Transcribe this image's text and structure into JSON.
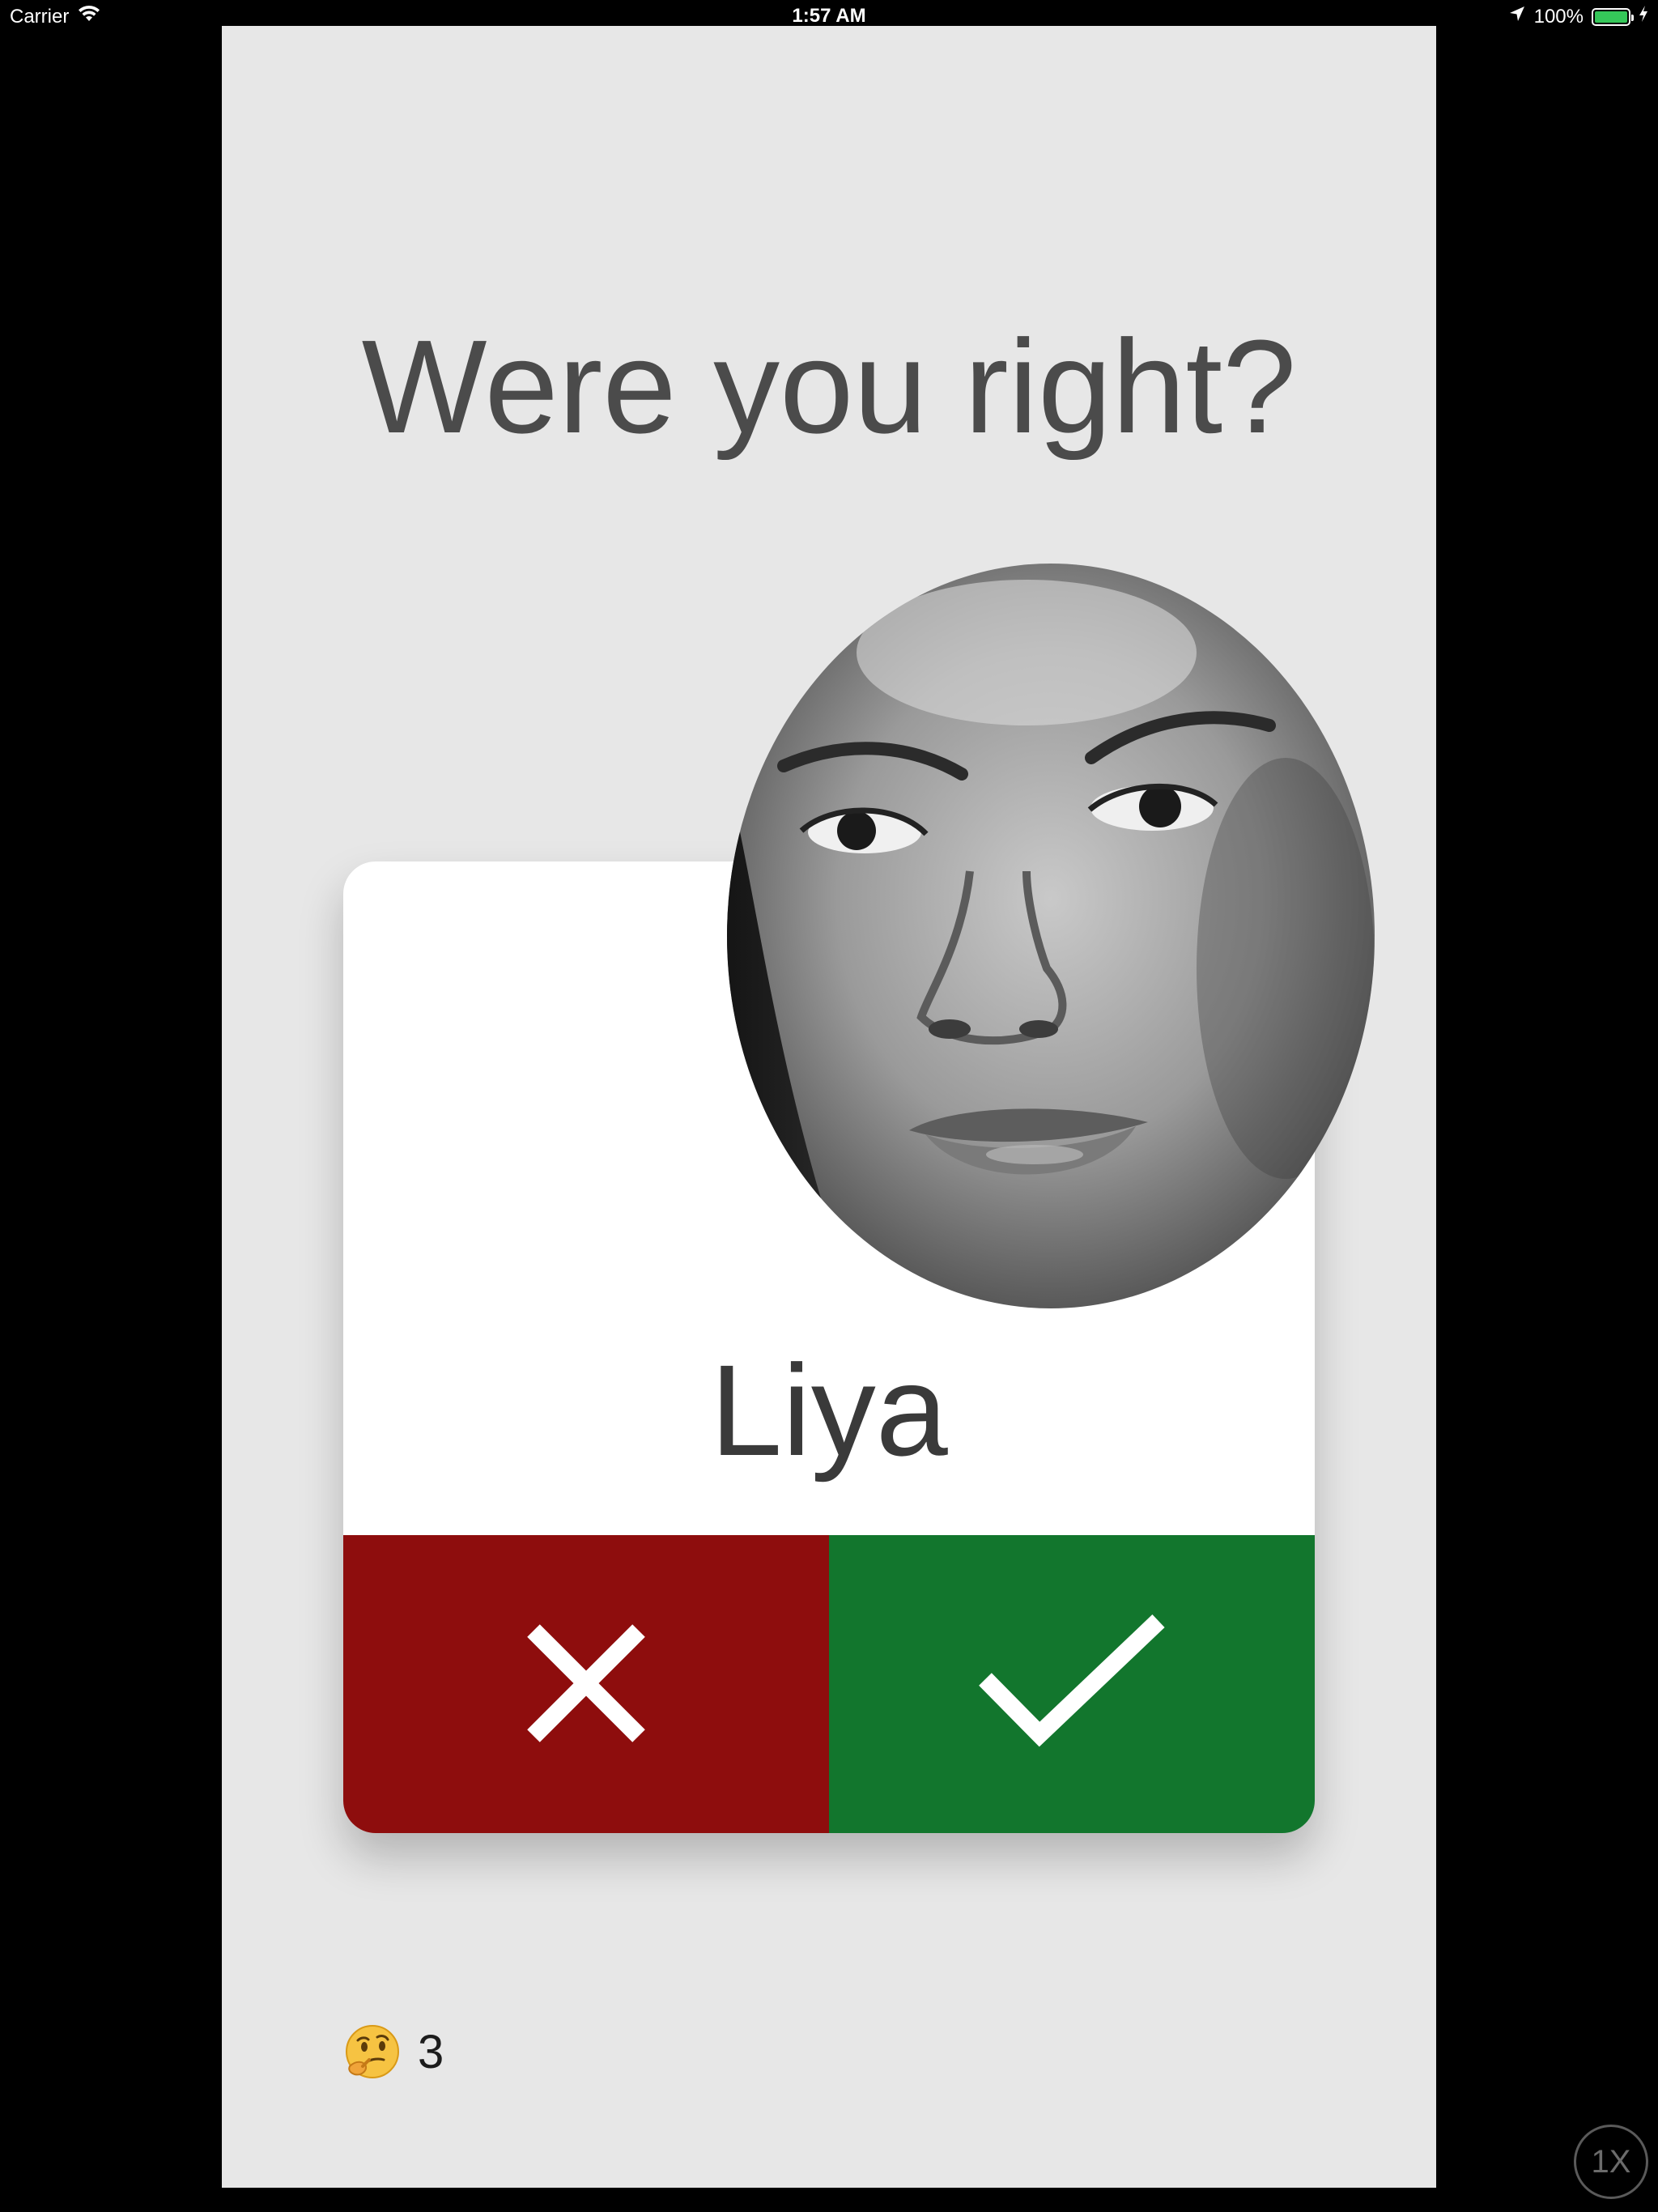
{
  "status_bar": {
    "carrier": "Carrier",
    "time": "1:57 AM",
    "battery_percent": "100%",
    "battery_level": 1.0,
    "battery_color": "#35c759"
  },
  "screen": {
    "title": "Were you right?",
    "background_color": "#e7e7e7"
  },
  "card": {
    "name": "Liya",
    "photo_icon": "face-photo",
    "wrong_button": {
      "icon": "close-icon",
      "color": "#8e0d0d"
    },
    "right_button": {
      "icon": "checkmark-icon",
      "color": "#12762d"
    }
  },
  "counter": {
    "emoji_icon": "thinking-face-icon",
    "value": "3"
  },
  "zoom_badge": {
    "label": "1X"
  }
}
